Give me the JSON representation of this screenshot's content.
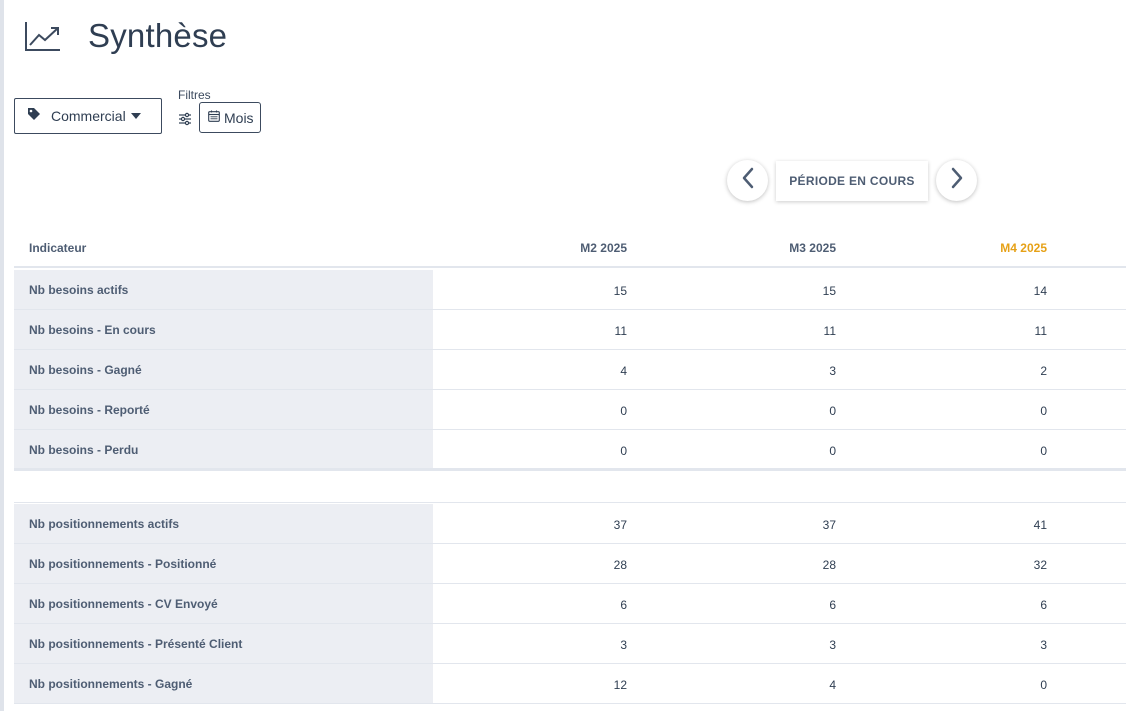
{
  "page": {
    "title": "Synthèse",
    "icon": "trending-chart-icon"
  },
  "toolbar": {
    "commercial_label": "Commercial",
    "filters_label": "Filtres",
    "mois_label": "Mois"
  },
  "period": {
    "current_label": "PÉRIODE EN COURS"
  },
  "table": {
    "header_indicator": "Indicateur",
    "columns": [
      "M2 2025",
      "M3 2025",
      "M4 2025"
    ],
    "current_column_color": "#e6a117",
    "groups": [
      {
        "rows": [
          {
            "label": "Nb besoins actifs",
            "values": [
              "15",
              "15",
              "14"
            ]
          },
          {
            "label": "Nb besoins - En cours",
            "values": [
              "11",
              "11",
              "11"
            ]
          },
          {
            "label": "Nb besoins - Gagné",
            "values": [
              "4",
              "3",
              "2"
            ]
          },
          {
            "label": "Nb besoins - Reporté",
            "values": [
              "0",
              "0",
              "0"
            ]
          },
          {
            "label": "Nb besoins - Perdu",
            "values": [
              "0",
              "0",
              "0"
            ]
          }
        ]
      },
      {
        "rows": [
          {
            "label": "Nb positionnements actifs",
            "values": [
              "37",
              "37",
              "41"
            ]
          },
          {
            "label": "Nb positionnements - Positionné",
            "values": [
              "28",
              "28",
              "32"
            ]
          },
          {
            "label": "Nb positionnements - CV Envoyé",
            "values": [
              "6",
              "6",
              "6"
            ]
          },
          {
            "label": "Nb positionnements - Présenté Client",
            "values": [
              "3",
              "3",
              "3"
            ]
          },
          {
            "label": "Nb positionnements - Gagné",
            "values": [
              "12",
              "4",
              "0"
            ]
          }
        ]
      }
    ]
  }
}
